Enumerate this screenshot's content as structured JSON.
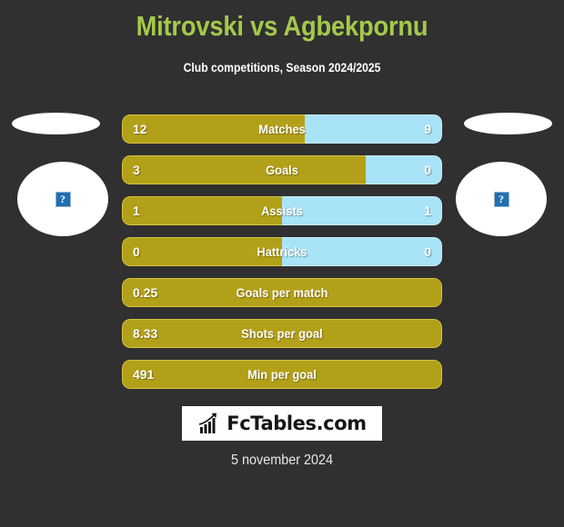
{
  "page": {
    "background_color": "#303030",
    "title": "Mitrovski vs Agbekpornu",
    "title_color": "#a5c84b",
    "subtitle": "Club competitions, Season 2024/2025",
    "date": "5 november 2024"
  },
  "colors": {
    "home": "#b3a019",
    "away": "#a9e3f7",
    "accent": "#a5c84b",
    "text": "#ffffff"
  },
  "players": {
    "home": {
      "name": "Mitrovski",
      "flag_icon": "flag-placeholder",
      "photo_icon": "broken-image-icon",
      "photo_glyph": "?"
    },
    "away": {
      "name": "Agbekpornu",
      "flag_icon": "flag-placeholder",
      "photo_icon": "broken-image-icon",
      "photo_glyph": "?"
    }
  },
  "stats": [
    {
      "label": "Matches",
      "home": "12",
      "away": "9",
      "home_pct": 57,
      "has_away": true
    },
    {
      "label": "Goals",
      "home": "3",
      "away": "0",
      "home_pct": 76,
      "has_away": true
    },
    {
      "label": "Assists",
      "home": "1",
      "away": "1",
      "home_pct": 50,
      "has_away": true
    },
    {
      "label": "Hattricks",
      "home": "0",
      "away": "0",
      "home_pct": 50,
      "has_away": true
    },
    {
      "label": "Goals per match",
      "home": "0.25",
      "away": "",
      "home_pct": 100,
      "has_away": false
    },
    {
      "label": "Shots per goal",
      "home": "8.33",
      "away": "",
      "home_pct": 100,
      "has_away": false
    },
    {
      "label": "Min per goal",
      "home": "491",
      "away": "",
      "home_pct": 100,
      "has_away": false
    }
  ],
  "footer": {
    "logo_icon": "bar-chart-arrow-icon",
    "logo_text": "FcTables.com"
  }
}
